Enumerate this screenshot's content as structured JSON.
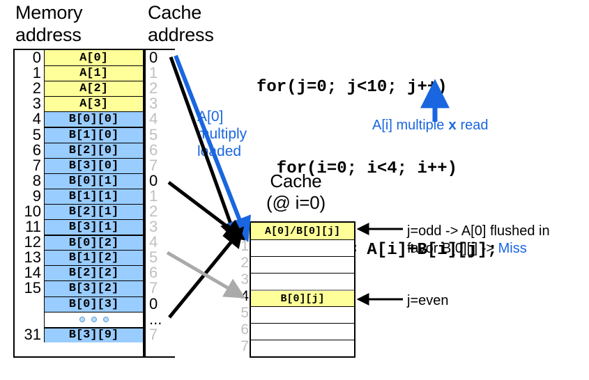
{
  "headings": {
    "memory_address": "Memory\naddress",
    "cache_address": "Cache\naddress",
    "cache_box": "Cache\n(@ i=0)"
  },
  "code": {
    "line1": "for(j=0; j<10; j++)",
    "line2": "  for(i=0; i<4; i++)",
    "line3": "    A[i] = A[i]+B[i][j];"
  },
  "annotations": {
    "a0_multiply_loaded": "A[0]\nmultiply\nloaded",
    "ai_multiple_read_pre": "A[i] multiple ",
    "ai_multiple_read_x": "x",
    "ai_multiple_read_post": " read",
    "j_odd_line1": "j=odd -> A[0] flushed in",
    "j_odd_line2_pre": "favor B[0][j] -> ",
    "j_odd_line2_miss": "Miss",
    "j_even": "j=even"
  },
  "colors": {
    "yellow": "#ffff99",
    "blue_fill": "#99ccff",
    "accent_blue": "#1a66e0",
    "gray_text": "#bfbfbf",
    "black": "#000000"
  },
  "memory_rows": [
    {
      "addr": "0",
      "value": "A[0]",
      "fill": "ylw",
      "thick": false
    },
    {
      "addr": "1",
      "value": "A[1]",
      "fill": "ylw",
      "thick": false
    },
    {
      "addr": "2",
      "value": "A[2]",
      "fill": "ylw",
      "thick": false
    },
    {
      "addr": "3",
      "value": "A[3]",
      "fill": "ylw",
      "thick": false
    },
    {
      "addr": "4",
      "value": "B[0][0]",
      "fill": "blu",
      "thick": false
    },
    {
      "addr": "5",
      "value": "B[1][0]",
      "fill": "blu",
      "thick": true
    },
    {
      "addr": "6",
      "value": "B[2][0]",
      "fill": "blu",
      "thick": false
    },
    {
      "addr": "7",
      "value": "B[3][0]",
      "fill": "blu",
      "thick": false
    },
    {
      "addr": "8",
      "value": "B[0][1]",
      "fill": "blu",
      "thick": false
    },
    {
      "addr": "9",
      "value": "B[1][1]",
      "fill": "blu",
      "thick": false
    },
    {
      "addr": "10",
      "value": "B[2][1]",
      "fill": "blu",
      "thick": false
    },
    {
      "addr": "11",
      "value": "B[3][1]",
      "fill": "blu",
      "thick": false
    },
    {
      "addr": "12",
      "value": "B[0][2]",
      "fill": "blu",
      "thick": true
    },
    {
      "addr": "13",
      "value": "B[1][2]",
      "fill": "blu",
      "thick": false
    },
    {
      "addr": "14",
      "value": "B[2][2]",
      "fill": "blu",
      "thick": false
    },
    {
      "addr": "15",
      "value": "B[3][2]",
      "fill": "blu",
      "thick": false
    },
    {
      "addr": "",
      "value": "B[0][3]",
      "fill": "blu",
      "thick": false
    },
    {
      "addr": "",
      "value": "DOTS",
      "fill": "wht",
      "thick": false
    },
    {
      "addr": "31",
      "value": "B[3][9]",
      "fill": "blu",
      "thick": true
    }
  ],
  "cache_address_column": [
    {
      "label": "0",
      "black": true
    },
    {
      "label": "1",
      "black": false
    },
    {
      "label": "2",
      "black": false
    },
    {
      "label": "3",
      "black": false
    },
    {
      "label": "4",
      "black": false
    },
    {
      "label": "5",
      "black": false
    },
    {
      "label": "6",
      "black": false
    },
    {
      "label": "7",
      "black": false
    },
    {
      "label": "0",
      "black": true
    },
    {
      "label": "1",
      "black": false
    },
    {
      "label": "2",
      "black": false
    },
    {
      "label": "3",
      "black": false
    },
    {
      "label": "4",
      "black": false
    },
    {
      "label": "5",
      "black": false
    },
    {
      "label": "6",
      "black": false
    },
    {
      "label": "7",
      "black": false
    },
    {
      "label": "0",
      "black": true
    },
    {
      "label": "...",
      "black": true
    },
    {
      "label": "7",
      "black": false
    }
  ],
  "cache_box_rows": [
    {
      "addr": "0",
      "addr_black": true,
      "value": "A[0]/B[0][j]",
      "filled": true
    },
    {
      "addr": "1",
      "addr_black": false,
      "value": "",
      "filled": false
    },
    {
      "addr": "2",
      "addr_black": false,
      "value": "",
      "filled": false
    },
    {
      "addr": "3",
      "addr_black": false,
      "value": "",
      "filled": false
    },
    {
      "addr": "4",
      "addr_black": true,
      "value": "B[0][j]",
      "filled": true
    },
    {
      "addr": "5",
      "addr_black": false,
      "value": "",
      "filled": false
    },
    {
      "addr": "6",
      "addr_black": false,
      "value": "",
      "filled": false
    },
    {
      "addr": "7",
      "addr_black": false,
      "value": "",
      "filled": false
    }
  ]
}
